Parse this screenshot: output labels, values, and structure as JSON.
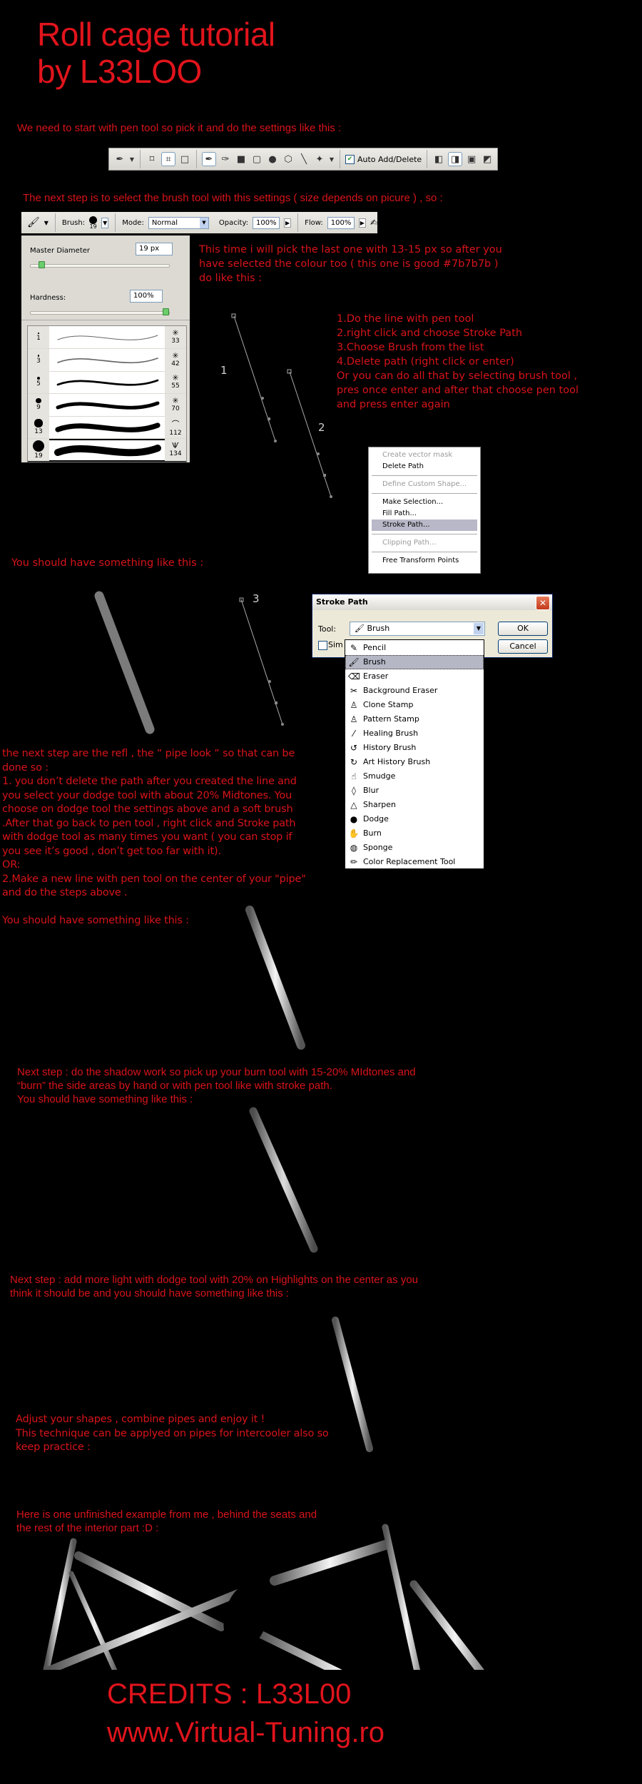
{
  "header": {
    "title_line1": "Roll cage tutorial",
    "title_line2": "by L33LOO"
  },
  "step_pen": {
    "text": "We need to start with pen tool so pick it and do the settings like this :",
    "toolbar": {
      "icons": [
        "pen-tool-icon",
        "dropdown-arrow-icon",
        "shape-layers-icon",
        "paths-icon",
        "fill-pixels-icon",
        "pen-icon",
        "freeform-pen-icon",
        "rectangle-icon",
        "rounded-rectangle-icon",
        "ellipse-icon",
        "polygon-icon",
        "line-icon",
        "custom-shape-icon",
        "dropdown-arrow-icon",
        "add-area-icon",
        "subtract-area-icon",
        "intersect-area-icon",
        "exclude-area-icon"
      ],
      "auto_add_delete_label": "Auto Add/Delete",
      "auto_add_delete_checked": true
    }
  },
  "step_brush": {
    "text": "The next step is to select the brush tool with this settings ( size depends on picure ) , so :",
    "options_bar": {
      "brush_label": "Brush:",
      "brush_size": "19",
      "mode_label": "Mode:",
      "mode_value": "Normal",
      "opacity_label": "Opacity:",
      "opacity_value": "100%",
      "flow_label": "Flow:",
      "flow_value": "100%"
    },
    "panel": {
      "master_diameter_label": "Master Diameter",
      "master_diameter_value": "19 px",
      "master_diameter_fraction": 0.08,
      "hardness_label": "Hardness:",
      "hardness_value": "100%",
      "hardness_fraction": 1.0,
      "presets": [
        {
          "size": "1",
          "right": "33"
        },
        {
          "size": "3",
          "right": "42"
        },
        {
          "size": "5",
          "right": "55"
        },
        {
          "size": "9",
          "right": "70"
        },
        {
          "size": "13",
          "right": "112"
        },
        {
          "size": "19",
          "right": "134",
          "selected": true
        }
      ]
    },
    "note": "This time i will pick the last one with 13-15 px so after you\nhave selected the colour too ( this one is good #7b7b7b )\ndo like this :",
    "steps": "1.Do the line with pen tool\n2.right click and choose Stroke Path\n3.Choose Brush from the list\n4.Delete path (right click or enter)\nOr you can do all that by selecting brush tool ,\npres once enter and after that choose pen tool\nand press enter again",
    "diagram_labels": [
      "1",
      "2",
      "3"
    ],
    "pipe_color": "#7b7b7b"
  },
  "context_menu": {
    "items": [
      {
        "label": "Create vector mask",
        "disabled": true
      },
      {
        "label": "Delete Path"
      },
      {
        "sep": true
      },
      {
        "label": "Define Custom Shape...",
        "disabled": true
      },
      {
        "sep": true
      },
      {
        "label": "Make Selection..."
      },
      {
        "label": "Fill Path..."
      },
      {
        "label": "Stroke Path...",
        "highlighted": true
      },
      {
        "sep": true
      },
      {
        "label": "Clipping Path...",
        "disabled": true
      },
      {
        "sep": true
      },
      {
        "label": "Free Transform Points"
      }
    ]
  },
  "result1": {
    "text": "You should have something like this :"
  },
  "stroke_dialog": {
    "title": "Stroke Path",
    "tool_label": "Tool:",
    "tool_value": "Brush",
    "simulate_label": "Sim",
    "ok_label": "OK",
    "cancel_label": "Cancel",
    "options": [
      {
        "label": "Pencil",
        "icon": "✎"
      },
      {
        "label": "Brush",
        "icon": "🖌",
        "highlighted": true
      },
      {
        "label": "Eraser",
        "icon": "⌫"
      },
      {
        "label": "Background Eraser",
        "icon": "✂"
      },
      {
        "label": "Clone Stamp",
        "icon": "♙"
      },
      {
        "label": "Pattern Stamp",
        "icon": "♙"
      },
      {
        "label": "Healing Brush",
        "icon": "⁄"
      },
      {
        "label": "History Brush",
        "icon": "↺"
      },
      {
        "label": "Art History Brush",
        "icon": "↻"
      },
      {
        "label": "Smudge",
        "icon": "☝"
      },
      {
        "label": "Blur",
        "icon": "◊"
      },
      {
        "label": "Sharpen",
        "icon": "△"
      },
      {
        "label": "Dodge",
        "icon": "●"
      },
      {
        "label": "Burn",
        "icon": "✋"
      },
      {
        "label": "Sponge",
        "icon": "◍"
      },
      {
        "label": "Color Replacement Tool",
        "icon": "✏"
      }
    ]
  },
  "step_refl": {
    "text": "the next step are the refl , the “ pipe look “ so that can be\ndone so :\n1. you don’t delete the path after you created the line and\nyou select your dodge tool with about 20% Midtones. You\nchoose on dodge tool the settings above and a soft brush\n.After that go back to pen tool , right click and Stroke path\nwith dodge tool as many times you want ( you can stop if\nyou see it’s good , don’t get too far with it).\nOR:\n2.Make a new line with pen tool on the center of your \"pipe\"\nand do the steps above .\n\nYou should have something like this :"
  },
  "step_shadow": {
    "text": "Next step : do the shadow work so pick up your burn tool with 15-20% MIdtones and\n“burn” the side areas by hand or with pen tool like with stroke path.\nYou should have something like this :"
  },
  "step_light": {
    "text": "Next step : add more light with dodge tool with 20% on Highlights on the center as you\nthink it should be and you should have something like this :"
  },
  "step_adjust": {
    "text": "Adjust your shapes , combine pipes and enjoy it !\nThis technique can be applyed on pipes for intercooler also so\nkeep practice :"
  },
  "step_example": {
    "text": "Here is one unfinished example from me , behind the seats and\nthe rest of the interior part :D :"
  },
  "credits": {
    "line1": "CREDITS : L33L00",
    "line2": "www.Virtual-Tuning.ro"
  }
}
